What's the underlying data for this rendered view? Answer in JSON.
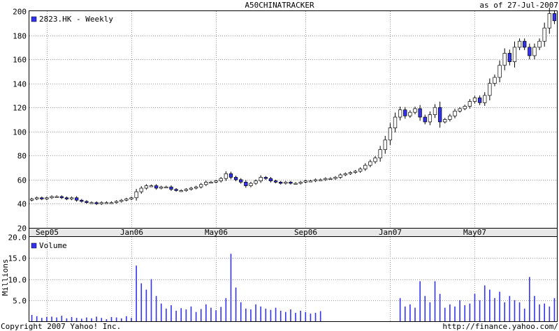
{
  "header": {
    "title": "A50CHINATRACKER",
    "as_of": "as of 27-Jul-2007"
  },
  "footer": {
    "copyright": "Copyright 2007 Yahoo! Inc.",
    "url": "http://finance.yahoo.com/"
  },
  "colors": {
    "up_candle": "#ffffff",
    "down_candle": "#3333ee",
    "volume_bar": "#3333ee",
    "grid": "#9a9a9a",
    "axis_band": "#e8e8e8"
  },
  "chart_data": [
    {
      "type": "candlestick",
      "legend": "2823.HK - Weekly",
      "legend_position": "top-left",
      "grid": true,
      "ylim": [
        20,
        200
      ],
      "yticks": [
        20,
        40,
        60,
        80,
        100,
        120,
        140,
        160,
        180,
        200
      ],
      "x_tick_labels": [
        "Sep05",
        "Jan06",
        "May06",
        "Sep06",
        "Jan07",
        "May07"
      ],
      "x_tick_weeks": [
        3.5,
        20.5,
        37.5,
        55.5,
        72.5,
        89.5
      ],
      "weeks": 106,
      "close": [
        44,
        45,
        44,
        45,
        46,
        46,
        45,
        44,
        45,
        43,
        42,
        41,
        41,
        40,
        41,
        41,
        41,
        42,
        43,
        44,
        45,
        50,
        53,
        55,
        55,
        53,
        54,
        54,
        52,
        51,
        51,
        52,
        53,
        54,
        56,
        58,
        58,
        59,
        61,
        65,
        62,
        60,
        58,
        55,
        57,
        59,
        62,
        61,
        59,
        58,
        57,
        58,
        57,
        57,
        58,
        59,
        59,
        60,
        60,
        61,
        61,
        62,
        64,
        65,
        66,
        67,
        69,
        72,
        75,
        78,
        85,
        93,
        103,
        112,
        118,
        113,
        116,
        119,
        112,
        108,
        114,
        120,
        108,
        110,
        113,
        117,
        119,
        121,
        125,
        128,
        124,
        130,
        140,
        145,
        155,
        165,
        158,
        170,
        175,
        170,
        163,
        170,
        175,
        186,
        198,
        192
      ],
      "volume": [
        1.5,
        1.2,
        0.8,
        1.0,
        1.1,
        0.9,
        1.3,
        0.7,
        1.0,
        0.8,
        0.6,
        0.9,
        0.7,
        1.1,
        0.8,
        0.5,
        1.0,
        0.9,
        0.7,
        1.2,
        0.8,
        13.2,
        9.0,
        7.5,
        10.0,
        6.0,
        4.2,
        3.0,
        3.8,
        2.5,
        3.1,
        2.8,
        3.5,
        2.2,
        2.9,
        4.0,
        3.2,
        2.6,
        3.4,
        5.5,
        16.0,
        8.0,
        4.5,
        3.0,
        2.8,
        4.0,
        3.5,
        3.0,
        2.7,
        3.2,
        2.5,
        2.2,
        2.8,
        2.0,
        2.5,
        2.2,
        1.8,
        2.0,
        2.4,
        0,
        0,
        0,
        0,
        0,
        0,
        0,
        0,
        0,
        0,
        0,
        0,
        0,
        0,
        0,
        5.5,
        3.5,
        4.0,
        3.2,
        9.5,
        6.0,
        4.5,
        9.5,
        6.5,
        3.2,
        4.0,
        3.5,
        5.0,
        3.8,
        4.2,
        6.5,
        5.0,
        8.5,
        7.5,
        5.5,
        7.0,
        4.5,
        6.0,
        5.0,
        4.5,
        3.0,
        10.5,
        6.0,
        4.0,
        4.2,
        3.5,
        5.5
      ],
      "volume_panel": {
        "legend": "Volume",
        "ylabel": "Millions",
        "ylim": [
          0,
          20
        ],
        "yticks": [
          5.0,
          10.0,
          15.0,
          20.0
        ]
      }
    }
  ]
}
